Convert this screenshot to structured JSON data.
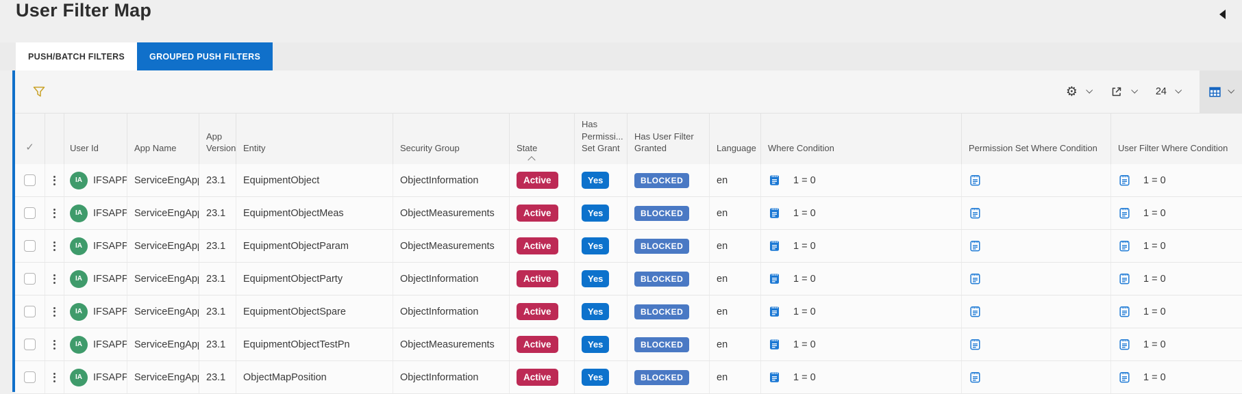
{
  "page": {
    "title": "User Filter Map"
  },
  "tabs": {
    "items": [
      {
        "label": "PUSH/BATCH FILTERS",
        "active": false
      },
      {
        "label": "GROUPED PUSH FILTERS",
        "active": true
      }
    ]
  },
  "toolbar": {
    "page_size": "24",
    "icons": {
      "filter": "funnel-outline-gold",
      "settings": "gear",
      "export": "share-arrow",
      "view_mode": "table-grid",
      "collapse": "left-triangle"
    }
  },
  "table": {
    "headers": {
      "user_id": "User Id",
      "app_name": "App Name",
      "app_version": "App Version",
      "entity": "Entity",
      "security_group": "Security Group",
      "state": "State",
      "has_permission_set_grant": "Has Permissi... Set Grant",
      "has_user_filter_granted": "Has User Filter Granted",
      "language": "Language",
      "where_condition": "Where Condition",
      "permission_set_where_condition": "Permission Set Where Condition",
      "user_filter_where_condition": "User Filter Where Condition"
    },
    "sort": {
      "column": "state",
      "direction": "ascending"
    },
    "rows": [
      {
        "avatar": "IA",
        "user_id": "IFSAPP",
        "app_name": "ServiceEngApp",
        "app_version": "23.1",
        "entity": "EquipmentObject",
        "security_group": "ObjectInformation",
        "state": "Active",
        "has_permission_set_grant": "Yes",
        "has_user_filter_granted": "BLOCKED",
        "language": "en",
        "where_condition": "1 = 0",
        "permission_set_where_condition": "",
        "user_filter_where_condition": "1 = 0"
      },
      {
        "avatar": "IA",
        "user_id": "IFSAPP",
        "app_name": "ServiceEngApp",
        "app_version": "23.1",
        "entity": "EquipmentObjectMeas",
        "security_group": "ObjectMeasurements",
        "state": "Active",
        "has_permission_set_grant": "Yes",
        "has_user_filter_granted": "BLOCKED",
        "language": "en",
        "where_condition": "1 = 0",
        "permission_set_where_condition": "",
        "user_filter_where_condition": "1 = 0"
      },
      {
        "avatar": "IA",
        "user_id": "IFSAPP",
        "app_name": "ServiceEngApp",
        "app_version": "23.1",
        "entity": "EquipmentObjectParam",
        "security_group": "ObjectMeasurements",
        "state": "Active",
        "has_permission_set_grant": "Yes",
        "has_user_filter_granted": "BLOCKED",
        "language": "en",
        "where_condition": "1 = 0",
        "permission_set_where_condition": "",
        "user_filter_where_condition": "1 = 0"
      },
      {
        "avatar": "IA",
        "user_id": "IFSAPP",
        "app_name": "ServiceEngApp",
        "app_version": "23.1",
        "entity": "EquipmentObjectParty",
        "security_group": "ObjectInformation",
        "state": "Active",
        "has_permission_set_grant": "Yes",
        "has_user_filter_granted": "BLOCKED",
        "language": "en",
        "where_condition": "1 = 0",
        "permission_set_where_condition": "",
        "user_filter_where_condition": "1 = 0"
      },
      {
        "avatar": "IA",
        "user_id": "IFSAPP",
        "app_name": "ServiceEngApp",
        "app_version": "23.1",
        "entity": "EquipmentObjectSpare",
        "security_group": "ObjectInformation",
        "state": "Active",
        "has_permission_set_grant": "Yes",
        "has_user_filter_granted": "BLOCKED",
        "language": "en",
        "where_condition": "1 = 0",
        "permission_set_where_condition": "",
        "user_filter_where_condition": "1 = 0"
      },
      {
        "avatar": "IA",
        "user_id": "IFSAPP",
        "app_name": "ServiceEngApp",
        "app_version": "23.1",
        "entity": "EquipmentObjectTestPn",
        "security_group": "ObjectMeasurements",
        "state": "Active",
        "has_permission_set_grant": "Yes",
        "has_user_filter_granted": "BLOCKED",
        "language": "en",
        "where_condition": "1 = 0",
        "permission_set_where_condition": "",
        "user_filter_where_condition": "1 = 0"
      },
      {
        "avatar": "IA",
        "user_id": "IFSAPP",
        "app_name": "ServiceEngApp",
        "app_version": "23.1",
        "entity": "ObjectMapPosition",
        "security_group": "ObjectInformation",
        "state": "Active",
        "has_permission_set_grant": "Yes",
        "has_user_filter_granted": "BLOCKED",
        "language": "en",
        "where_condition": "1 = 0",
        "permission_set_where_condition": "",
        "user_filter_where_condition": "1 = 0"
      }
    ]
  },
  "colors": {
    "accent_blue": "#1070ca",
    "state_badge_red": "#bd2a55",
    "yes_badge_blue": "#0d72cc",
    "blocked_badge_steel_blue": "#4a79c4",
    "avatar_green": "#3f9b6b",
    "condition_icon_blue": "#1b78d4",
    "filter_icon_gold": "#c9a227"
  }
}
